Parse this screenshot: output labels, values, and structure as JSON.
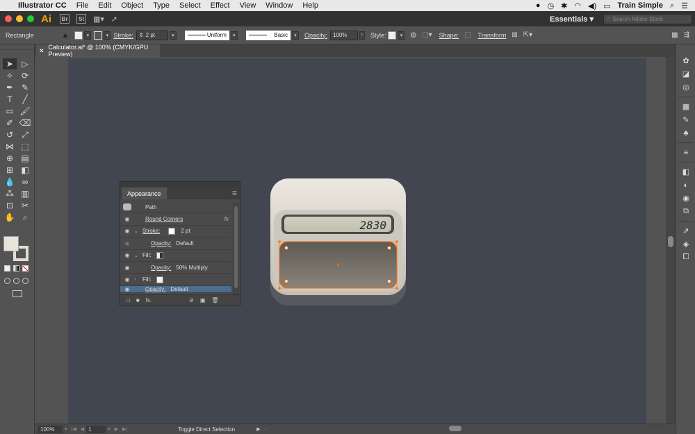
{
  "menubar": {
    "apple": "",
    "app_name": "Illustrator CC",
    "menus": [
      "File",
      "Edit",
      "Object",
      "Type",
      "Select",
      "Effect",
      "View",
      "Window",
      "Help"
    ],
    "user": "Train Simple"
  },
  "appbar": {
    "logo": "Ai",
    "bridge": "Br",
    "stock": "St",
    "workspace": "Essentials",
    "stock_search_placeholder": "Search Adobe Stock"
  },
  "control": {
    "object_type": "Rectangle",
    "stroke_label": "Stroke:",
    "stroke_weight": "2 pt",
    "profile": "Uniform",
    "brush": "Basic",
    "opacity_label": "Opacity:",
    "opacity_value": "100%",
    "style_label": "Style:",
    "shape_label": "Shape:",
    "transform_label": "Transform"
  },
  "document": {
    "tab_title": "Calculator.ai* @ 100% (CMYK/GPU Preview)",
    "display_value": "2830"
  },
  "appearance": {
    "title": "Appearance",
    "rows": [
      {
        "label": "Path"
      },
      {
        "label": "Round Corners"
      },
      {
        "label": "Stroke:",
        "value": "2 pt"
      },
      {
        "label": "Opacity:",
        "value": "Default"
      },
      {
        "label": "Fill:"
      },
      {
        "label": "Opacity:",
        "value": "50% Multiply"
      },
      {
        "label": "Fill:"
      },
      {
        "label": "Opacity:",
        "value": "Default"
      }
    ]
  },
  "status": {
    "zoom": "100%",
    "page": "1",
    "message": "Toggle Direct Selection"
  },
  "colors": {
    "artboard": "#414650",
    "selection": "#ff6a00",
    "accent": "#ff9a00"
  }
}
